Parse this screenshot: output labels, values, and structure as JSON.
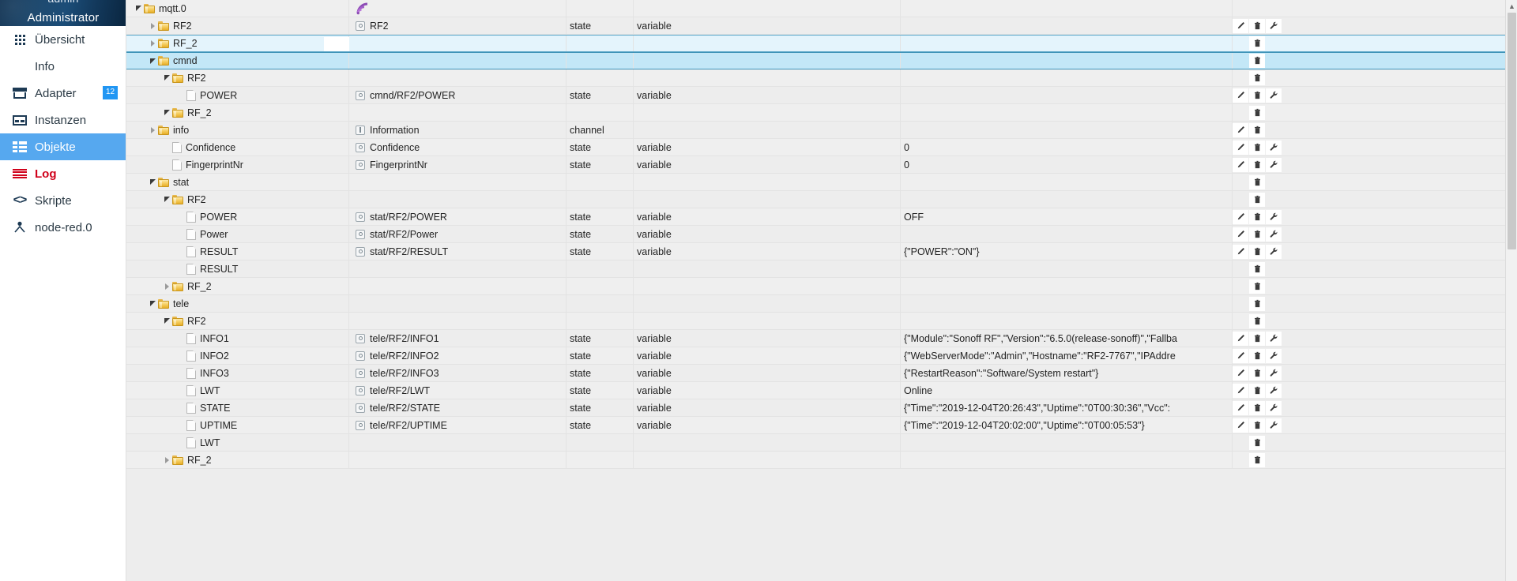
{
  "sidebar": {
    "user_top": "admin",
    "user": "Administrator",
    "items": [
      {
        "label": "Übersicht",
        "icon": "grid-icon",
        "badge": ""
      },
      {
        "label": "Info",
        "icon": "info-icon",
        "badge": ""
      },
      {
        "label": "Adapter",
        "icon": "store-icon",
        "badge": "12"
      },
      {
        "label": "Instanzen",
        "icon": "instances-icon",
        "badge": ""
      },
      {
        "label": "Objekte",
        "icon": "objects-icon",
        "badge": ""
      },
      {
        "label": "Log",
        "icon": "log-icon",
        "badge": ""
      },
      {
        "label": "Skripte",
        "icon": "code-icon",
        "badge": ""
      },
      {
        "label": "node-red.0",
        "icon": "person-icon",
        "badge": ""
      }
    ],
    "active_index": 4,
    "accent_color": "#56a8ef",
    "log_color": "#d0021b",
    "badge_color": "#2196f3"
  },
  "table": {
    "buttons": {
      "edit": "edit-pencil",
      "delete": "trash",
      "settings": "wrench"
    },
    "copy_badge": "copy",
    "rows": [
      {
        "indent": 0,
        "toggle": "open",
        "icon": "folder",
        "name": "mqtt.0",
        "id": "",
        "id_icon": "mqtt-logo",
        "type": "",
        "role": "",
        "value": "",
        "buttons": []
      },
      {
        "indent": 1,
        "toggle": "closed",
        "icon": "folder",
        "name": "RF2",
        "id": "RF2",
        "id_icon": "state",
        "type": "state",
        "role": "variable",
        "value": "",
        "buttons": [
          "edit",
          "delete",
          "settings"
        ]
      },
      {
        "indent": 1,
        "toggle": "closed",
        "icon": "folder",
        "name": "RF_2",
        "id": "",
        "id_icon": "",
        "type": "",
        "role": "",
        "value": "",
        "buttons": [
          "delete"
        ],
        "state": "hover",
        "copy": true
      },
      {
        "indent": 1,
        "toggle": "open",
        "icon": "folder",
        "name": "cmnd",
        "id": "",
        "id_icon": "",
        "type": "",
        "role": "",
        "value": "",
        "buttons": [
          "delete"
        ],
        "state": "selected"
      },
      {
        "indent": 2,
        "toggle": "open",
        "icon": "folder",
        "name": "RF2",
        "id": "",
        "id_icon": "",
        "type": "",
        "role": "",
        "value": "",
        "buttons": [
          "delete"
        ]
      },
      {
        "indent": 3,
        "toggle": "none",
        "icon": "file",
        "name": "POWER",
        "id": "cmnd/RF2/POWER",
        "id_icon": "state",
        "type": "state",
        "role": "variable",
        "value": "",
        "buttons": [
          "edit",
          "delete",
          "settings"
        ]
      },
      {
        "indent": 2,
        "toggle": "open",
        "icon": "folder",
        "name": "RF_2",
        "id": "",
        "id_icon": "",
        "type": "",
        "role": "",
        "value": "",
        "buttons": [
          "delete"
        ]
      },
      {
        "indent": 1,
        "toggle": "closed",
        "icon": "folder",
        "name": "info",
        "id": "Information",
        "id_icon": "channel",
        "type": "channel",
        "role": "",
        "value": "",
        "buttons": [
          "edit",
          "delete"
        ]
      },
      {
        "indent": 2,
        "toggle": "none",
        "icon": "file",
        "name": "Confidence",
        "id": "Confidence",
        "id_icon": "state",
        "type": "state",
        "role": "variable",
        "value": "0",
        "buttons": [
          "edit",
          "delete",
          "settings"
        ]
      },
      {
        "indent": 2,
        "toggle": "none",
        "icon": "file",
        "name": "FingerprintNr",
        "id": "FingerprintNr",
        "id_icon": "state",
        "type": "state",
        "role": "variable",
        "value": "0",
        "buttons": [
          "edit",
          "delete",
          "settings"
        ]
      },
      {
        "indent": 1,
        "toggle": "open",
        "icon": "folder",
        "name": "stat",
        "id": "",
        "id_icon": "",
        "type": "",
        "role": "",
        "value": "",
        "buttons": [
          "delete"
        ]
      },
      {
        "indent": 2,
        "toggle": "open",
        "icon": "folder",
        "name": "RF2",
        "id": "",
        "id_icon": "",
        "type": "",
        "role": "",
        "value": "",
        "buttons": [
          "delete"
        ]
      },
      {
        "indent": 3,
        "toggle": "none",
        "icon": "file",
        "name": "POWER",
        "id": "stat/RF2/POWER",
        "id_icon": "state",
        "type": "state",
        "role": "variable",
        "value": "OFF",
        "buttons": [
          "edit",
          "delete",
          "settings"
        ]
      },
      {
        "indent": 3,
        "toggle": "none",
        "icon": "file",
        "name": "Power",
        "id": "stat/RF2/Power",
        "id_icon": "state",
        "type": "state",
        "role": "variable",
        "value": "",
        "buttons": [
          "edit",
          "delete",
          "settings"
        ]
      },
      {
        "indent": 3,
        "toggle": "none",
        "icon": "file",
        "name": "RESULT",
        "id": "stat/RF2/RESULT",
        "id_icon": "state",
        "type": "state",
        "role": "variable",
        "value": "{\"POWER\":\"ON\"}",
        "buttons": [
          "edit",
          "delete",
          "settings"
        ]
      },
      {
        "indent": 3,
        "toggle": "none",
        "icon": "file",
        "name": "RESULT",
        "id": "",
        "id_icon": "",
        "type": "",
        "role": "",
        "value": "",
        "buttons": [
          "delete"
        ]
      },
      {
        "indent": 2,
        "toggle": "closed",
        "icon": "folder",
        "name": "RF_2",
        "id": "",
        "id_icon": "",
        "type": "",
        "role": "",
        "value": "",
        "buttons": [
          "delete"
        ]
      },
      {
        "indent": 1,
        "toggle": "open",
        "icon": "folder",
        "name": "tele",
        "id": "",
        "id_icon": "",
        "type": "",
        "role": "",
        "value": "",
        "buttons": [
          "delete"
        ]
      },
      {
        "indent": 2,
        "toggle": "open",
        "icon": "folder",
        "name": "RF2",
        "id": "",
        "id_icon": "",
        "type": "",
        "role": "",
        "value": "",
        "buttons": [
          "delete"
        ]
      },
      {
        "indent": 3,
        "toggle": "none",
        "icon": "file",
        "name": "INFO1",
        "id": "tele/RF2/INFO1",
        "id_icon": "state",
        "type": "state",
        "role": "variable",
        "value": "{\"Module\":\"Sonoff RF\",\"Version\":\"6.5.0(release-sonoff)\",\"Fallba",
        "buttons": [
          "edit",
          "delete",
          "settings"
        ]
      },
      {
        "indent": 3,
        "toggle": "none",
        "icon": "file",
        "name": "INFO2",
        "id": "tele/RF2/INFO2",
        "id_icon": "state",
        "type": "state",
        "role": "variable",
        "value": "{\"WebServerMode\":\"Admin\",\"Hostname\":\"RF2-7767\",\"IPAddre",
        "buttons": [
          "edit",
          "delete",
          "settings"
        ]
      },
      {
        "indent": 3,
        "toggle": "none",
        "icon": "file",
        "name": "INFO3",
        "id": "tele/RF2/INFO3",
        "id_icon": "state",
        "type": "state",
        "role": "variable",
        "value": "{\"RestartReason\":\"Software/System restart\"}",
        "buttons": [
          "edit",
          "delete",
          "settings"
        ]
      },
      {
        "indent": 3,
        "toggle": "none",
        "icon": "file",
        "name": "LWT",
        "id": "tele/RF2/LWT",
        "id_icon": "state",
        "type": "state",
        "role": "variable",
        "value": "Online",
        "buttons": [
          "edit",
          "delete",
          "settings"
        ]
      },
      {
        "indent": 3,
        "toggle": "none",
        "icon": "file",
        "name": "STATE",
        "id": "tele/RF2/STATE",
        "id_icon": "state",
        "type": "state",
        "role": "variable",
        "value": "{\"Time\":\"2019-12-04T20:26:43\",\"Uptime\":\"0T00:30:36\",\"Vcc\":",
        "buttons": [
          "edit",
          "delete",
          "settings"
        ]
      },
      {
        "indent": 3,
        "toggle": "none",
        "icon": "file",
        "name": "UPTIME",
        "id": "tele/RF2/UPTIME",
        "id_icon": "state",
        "type": "state",
        "role": "variable",
        "value": "{\"Time\":\"2019-12-04T20:02:00\",\"Uptime\":\"0T00:05:53\"}",
        "buttons": [
          "edit",
          "delete",
          "settings"
        ]
      },
      {
        "indent": 3,
        "toggle": "none",
        "icon": "file",
        "name": "LWT",
        "id": "",
        "id_icon": "",
        "type": "",
        "role": "",
        "value": "",
        "buttons": [
          "delete"
        ]
      },
      {
        "indent": 2,
        "toggle": "closed",
        "icon": "folder",
        "name": "RF_2",
        "id": "",
        "id_icon": "",
        "type": "",
        "role": "",
        "value": "",
        "buttons": [
          "delete"
        ]
      }
    ]
  }
}
